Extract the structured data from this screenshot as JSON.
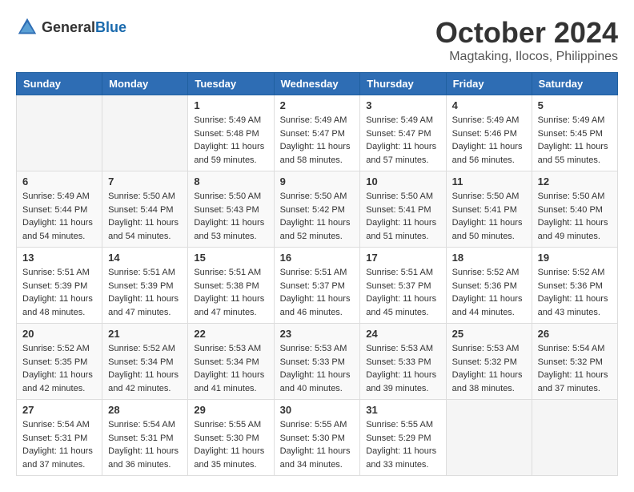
{
  "header": {
    "logo_general": "General",
    "logo_blue": "Blue",
    "month_title": "October 2024",
    "location": "Magtaking, Ilocos, Philippines"
  },
  "days_of_week": [
    "Sunday",
    "Monday",
    "Tuesday",
    "Wednesday",
    "Thursday",
    "Friday",
    "Saturday"
  ],
  "weeks": [
    [
      {
        "day": "",
        "sunrise": "",
        "sunset": "",
        "daylight": ""
      },
      {
        "day": "",
        "sunrise": "",
        "sunset": "",
        "daylight": ""
      },
      {
        "day": "1",
        "sunrise": "Sunrise: 5:49 AM",
        "sunset": "Sunset: 5:48 PM",
        "daylight": "Daylight: 11 hours and 59 minutes."
      },
      {
        "day": "2",
        "sunrise": "Sunrise: 5:49 AM",
        "sunset": "Sunset: 5:47 PM",
        "daylight": "Daylight: 11 hours and 58 minutes."
      },
      {
        "day": "3",
        "sunrise": "Sunrise: 5:49 AM",
        "sunset": "Sunset: 5:47 PM",
        "daylight": "Daylight: 11 hours and 57 minutes."
      },
      {
        "day": "4",
        "sunrise": "Sunrise: 5:49 AM",
        "sunset": "Sunset: 5:46 PM",
        "daylight": "Daylight: 11 hours and 56 minutes."
      },
      {
        "day": "5",
        "sunrise": "Sunrise: 5:49 AM",
        "sunset": "Sunset: 5:45 PM",
        "daylight": "Daylight: 11 hours and 55 minutes."
      }
    ],
    [
      {
        "day": "6",
        "sunrise": "Sunrise: 5:49 AM",
        "sunset": "Sunset: 5:44 PM",
        "daylight": "Daylight: 11 hours and 54 minutes."
      },
      {
        "day": "7",
        "sunrise": "Sunrise: 5:50 AM",
        "sunset": "Sunset: 5:44 PM",
        "daylight": "Daylight: 11 hours and 54 minutes."
      },
      {
        "day": "8",
        "sunrise": "Sunrise: 5:50 AM",
        "sunset": "Sunset: 5:43 PM",
        "daylight": "Daylight: 11 hours and 53 minutes."
      },
      {
        "day": "9",
        "sunrise": "Sunrise: 5:50 AM",
        "sunset": "Sunset: 5:42 PM",
        "daylight": "Daylight: 11 hours and 52 minutes."
      },
      {
        "day": "10",
        "sunrise": "Sunrise: 5:50 AM",
        "sunset": "Sunset: 5:41 PM",
        "daylight": "Daylight: 11 hours and 51 minutes."
      },
      {
        "day": "11",
        "sunrise": "Sunrise: 5:50 AM",
        "sunset": "Sunset: 5:41 PM",
        "daylight": "Daylight: 11 hours and 50 minutes."
      },
      {
        "day": "12",
        "sunrise": "Sunrise: 5:50 AM",
        "sunset": "Sunset: 5:40 PM",
        "daylight": "Daylight: 11 hours and 49 minutes."
      }
    ],
    [
      {
        "day": "13",
        "sunrise": "Sunrise: 5:51 AM",
        "sunset": "Sunset: 5:39 PM",
        "daylight": "Daylight: 11 hours and 48 minutes."
      },
      {
        "day": "14",
        "sunrise": "Sunrise: 5:51 AM",
        "sunset": "Sunset: 5:39 PM",
        "daylight": "Daylight: 11 hours and 47 minutes."
      },
      {
        "day": "15",
        "sunrise": "Sunrise: 5:51 AM",
        "sunset": "Sunset: 5:38 PM",
        "daylight": "Daylight: 11 hours and 47 minutes."
      },
      {
        "day": "16",
        "sunrise": "Sunrise: 5:51 AM",
        "sunset": "Sunset: 5:37 PM",
        "daylight": "Daylight: 11 hours and 46 minutes."
      },
      {
        "day": "17",
        "sunrise": "Sunrise: 5:51 AM",
        "sunset": "Sunset: 5:37 PM",
        "daylight": "Daylight: 11 hours and 45 minutes."
      },
      {
        "day": "18",
        "sunrise": "Sunrise: 5:52 AM",
        "sunset": "Sunset: 5:36 PM",
        "daylight": "Daylight: 11 hours and 44 minutes."
      },
      {
        "day": "19",
        "sunrise": "Sunrise: 5:52 AM",
        "sunset": "Sunset: 5:36 PM",
        "daylight": "Daylight: 11 hours and 43 minutes."
      }
    ],
    [
      {
        "day": "20",
        "sunrise": "Sunrise: 5:52 AM",
        "sunset": "Sunset: 5:35 PM",
        "daylight": "Daylight: 11 hours and 42 minutes."
      },
      {
        "day": "21",
        "sunrise": "Sunrise: 5:52 AM",
        "sunset": "Sunset: 5:34 PM",
        "daylight": "Daylight: 11 hours and 42 minutes."
      },
      {
        "day": "22",
        "sunrise": "Sunrise: 5:53 AM",
        "sunset": "Sunset: 5:34 PM",
        "daylight": "Daylight: 11 hours and 41 minutes."
      },
      {
        "day": "23",
        "sunrise": "Sunrise: 5:53 AM",
        "sunset": "Sunset: 5:33 PM",
        "daylight": "Daylight: 11 hours and 40 minutes."
      },
      {
        "day": "24",
        "sunrise": "Sunrise: 5:53 AM",
        "sunset": "Sunset: 5:33 PM",
        "daylight": "Daylight: 11 hours and 39 minutes."
      },
      {
        "day": "25",
        "sunrise": "Sunrise: 5:53 AM",
        "sunset": "Sunset: 5:32 PM",
        "daylight": "Daylight: 11 hours and 38 minutes."
      },
      {
        "day": "26",
        "sunrise": "Sunrise: 5:54 AM",
        "sunset": "Sunset: 5:32 PM",
        "daylight": "Daylight: 11 hours and 37 minutes."
      }
    ],
    [
      {
        "day": "27",
        "sunrise": "Sunrise: 5:54 AM",
        "sunset": "Sunset: 5:31 PM",
        "daylight": "Daylight: 11 hours and 37 minutes."
      },
      {
        "day": "28",
        "sunrise": "Sunrise: 5:54 AM",
        "sunset": "Sunset: 5:31 PM",
        "daylight": "Daylight: 11 hours and 36 minutes."
      },
      {
        "day": "29",
        "sunrise": "Sunrise: 5:55 AM",
        "sunset": "Sunset: 5:30 PM",
        "daylight": "Daylight: 11 hours and 35 minutes."
      },
      {
        "day": "30",
        "sunrise": "Sunrise: 5:55 AM",
        "sunset": "Sunset: 5:30 PM",
        "daylight": "Daylight: 11 hours and 34 minutes."
      },
      {
        "day": "31",
        "sunrise": "Sunrise: 5:55 AM",
        "sunset": "Sunset: 5:29 PM",
        "daylight": "Daylight: 11 hours and 33 minutes."
      },
      {
        "day": "",
        "sunrise": "",
        "sunset": "",
        "daylight": ""
      },
      {
        "day": "",
        "sunrise": "",
        "sunset": "",
        "daylight": ""
      }
    ]
  ]
}
